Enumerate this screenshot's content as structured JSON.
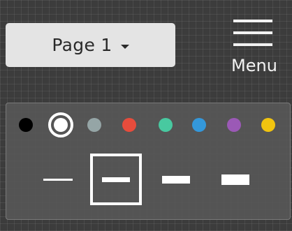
{
  "page_select": {
    "label": "Page 1",
    "icon": "caret-down-icon"
  },
  "menu": {
    "label": "Menu",
    "icon": "hamburger-icon"
  },
  "colors": [
    {
      "name": "black",
      "hex": "#000000",
      "selected": false
    },
    {
      "name": "white",
      "hex": "#ffffff",
      "selected": true
    },
    {
      "name": "gray",
      "hex": "#95a5a6",
      "selected": false
    },
    {
      "name": "red",
      "hex": "#e74c3c",
      "selected": false
    },
    {
      "name": "green",
      "hex": "#48c9a0",
      "selected": false
    },
    {
      "name": "blue",
      "hex": "#3498db",
      "selected": false
    },
    {
      "name": "purple",
      "hex": "#9b59b6",
      "selected": false
    },
    {
      "name": "yellow",
      "hex": "#f1c40f",
      "selected": false
    }
  ],
  "strokes": [
    {
      "name": "thin",
      "selected": false
    },
    {
      "name": "medium",
      "selected": true
    },
    {
      "name": "thick",
      "selected": false
    },
    {
      "name": "extra-thick",
      "selected": false
    }
  ],
  "theme": {
    "background": "#3c3c3c",
    "dropdown_bg": "#e4e4e4",
    "panel_bg": "#585858",
    "foreground": "#ffffff"
  }
}
